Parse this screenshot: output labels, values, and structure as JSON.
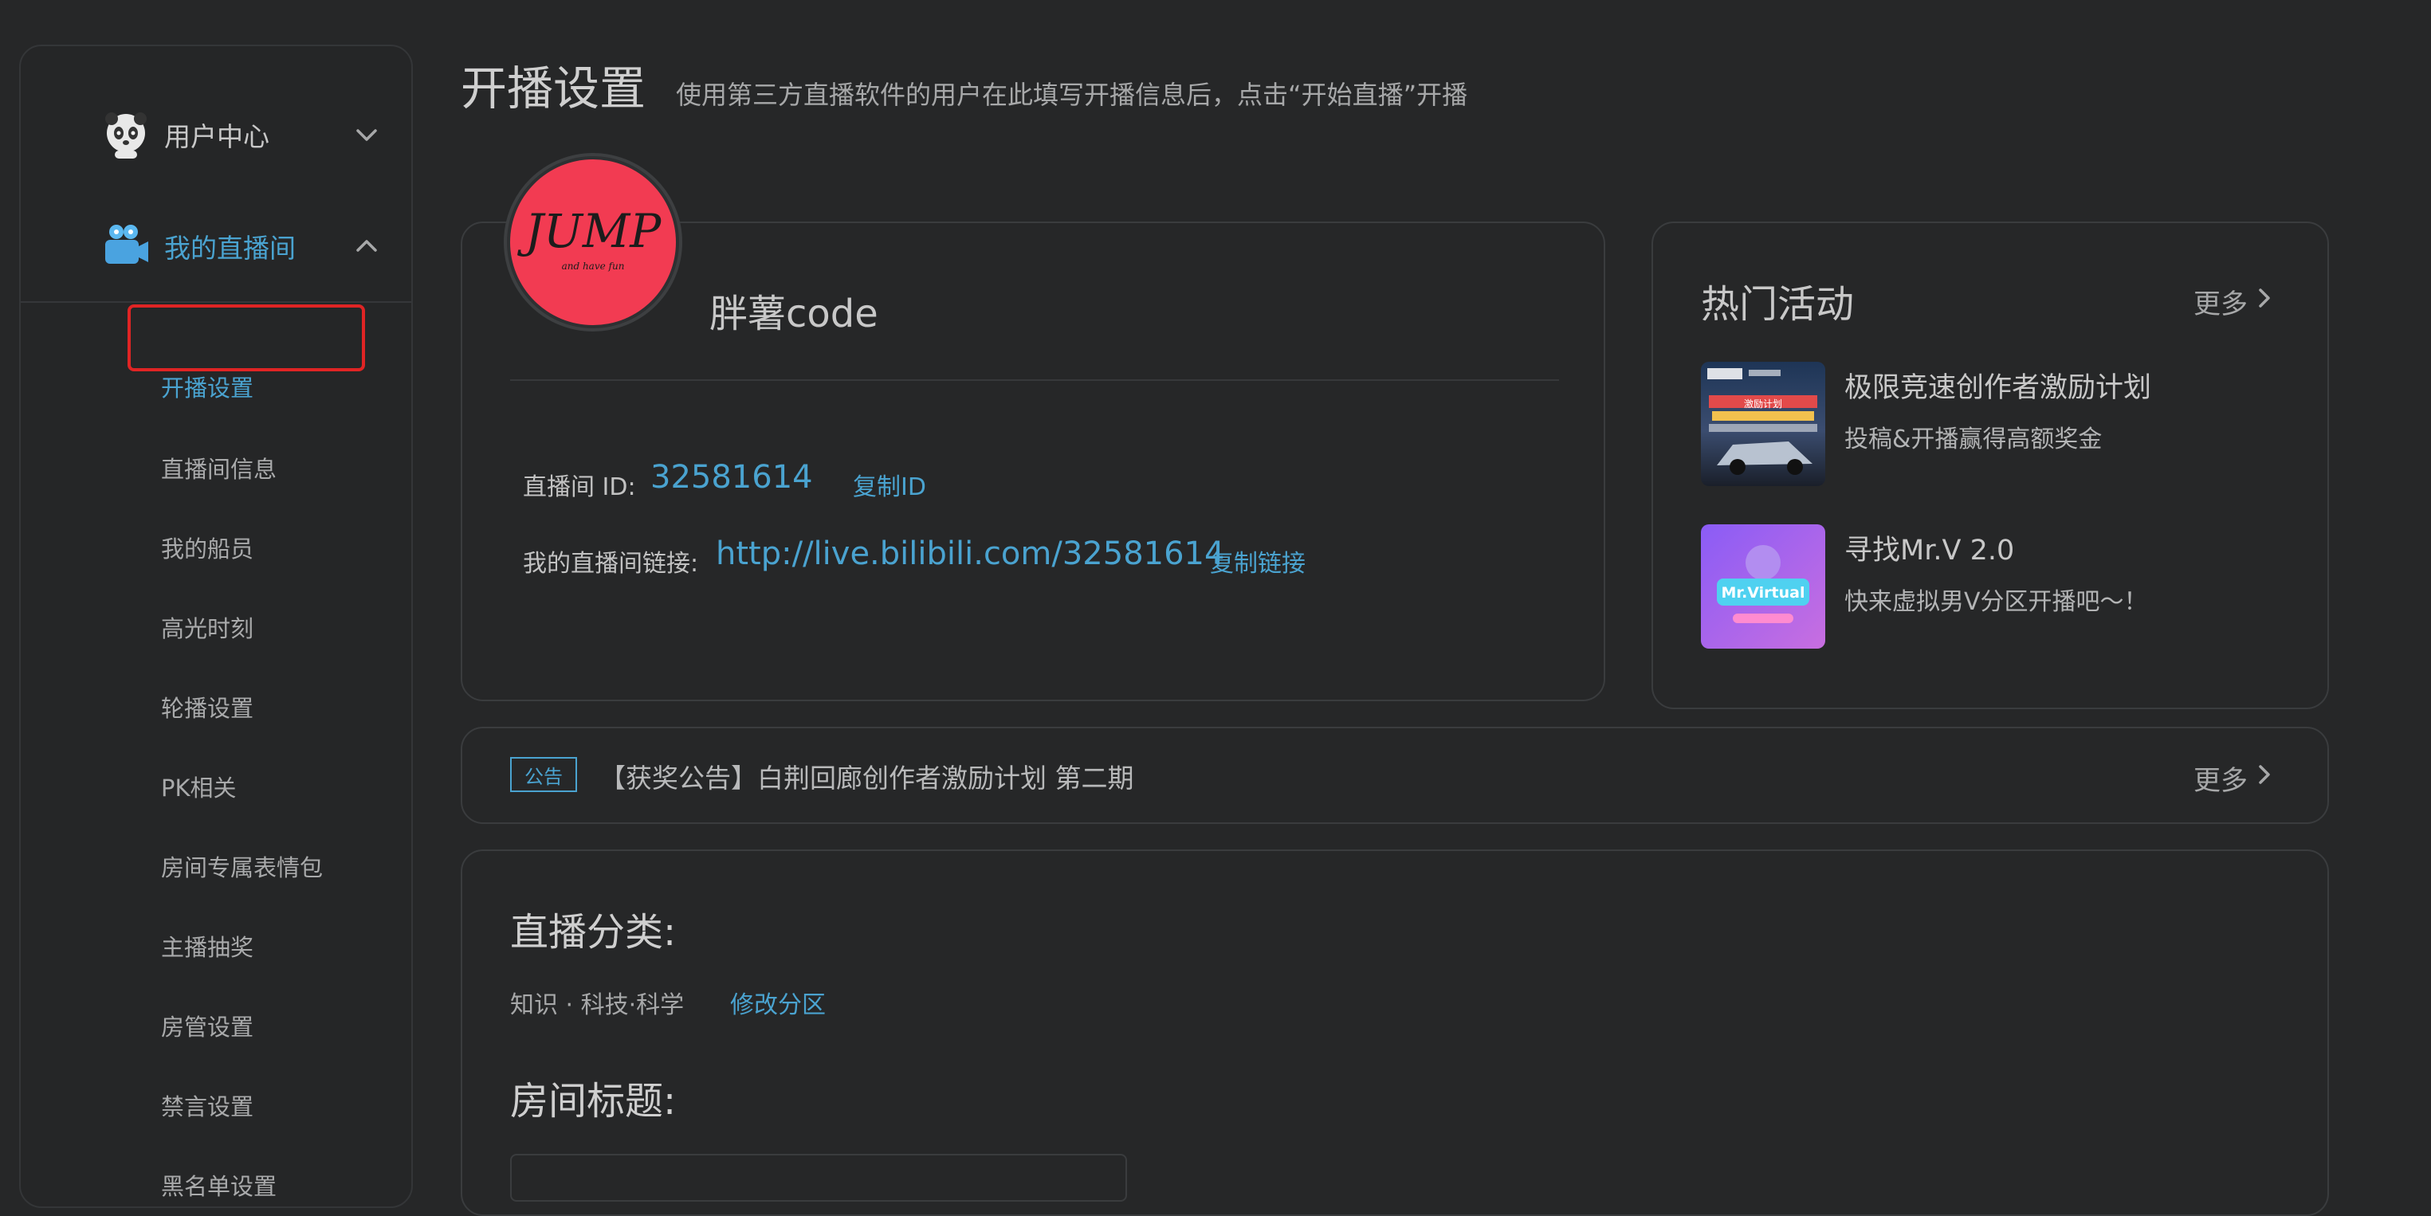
{
  "sidebar": {
    "groups": [
      {
        "label": "用户中心",
        "icon": "panda-avatar-icon",
        "expanded": false
      },
      {
        "label": "我的直播间",
        "icon": "video-camera-icon",
        "expanded": true
      }
    ],
    "items": [
      {
        "label": "开播设置",
        "active": true
      },
      {
        "label": "直播间信息"
      },
      {
        "label": "我的船员"
      },
      {
        "label": "高光时刻"
      },
      {
        "label": "轮播设置"
      },
      {
        "label": "PK相关"
      },
      {
        "label": "房间专属表情包"
      },
      {
        "label": "主播抽奖"
      },
      {
        "label": "房管设置"
      },
      {
        "label": "禁言设置"
      },
      {
        "label": "黑名单设置"
      }
    ]
  },
  "header": {
    "title": "开播设置",
    "subtitle": "使用第三方直播软件的用户在此填写开播信息后，点击“开始直播”开播"
  },
  "room": {
    "avatar_text": "JUMP",
    "avatar_caption": "and have fun",
    "username": "胖薯code",
    "id_label": "直播间 ID:",
    "id_value": "32581614",
    "copy_id": "复制ID",
    "link_label": "我的直播间链接:",
    "link_value": "http://live.bilibili.com/32581614",
    "copy_link": "复制链接"
  },
  "hot": {
    "title": "热门活动",
    "more": "更多",
    "activities": [
      {
        "title": "极限竞速创作者激励计划",
        "desc": "投稿&开播赢得高额奖金",
        "thumb_text": "激励计划"
      },
      {
        "title": "寻找Mr.V 2.0",
        "desc": "快来虚拟男V分区开播吧～！",
        "thumb_text": "Mr.Virtual"
      }
    ]
  },
  "notice": {
    "badge": "公告",
    "text": "【获奖公告】白荆回廊创作者激励计划 第二期",
    "more": "更多"
  },
  "live": {
    "category_title": "直播分类:",
    "category_value": "知识 · 科技·科学",
    "change_category": "修改分区",
    "room_title_label": "房间标题:"
  },
  "colors": {
    "accent": "#4aa3d0",
    "background": "#262728",
    "highlight_box": "#e02424",
    "avatar_bg": "#f23b52"
  }
}
